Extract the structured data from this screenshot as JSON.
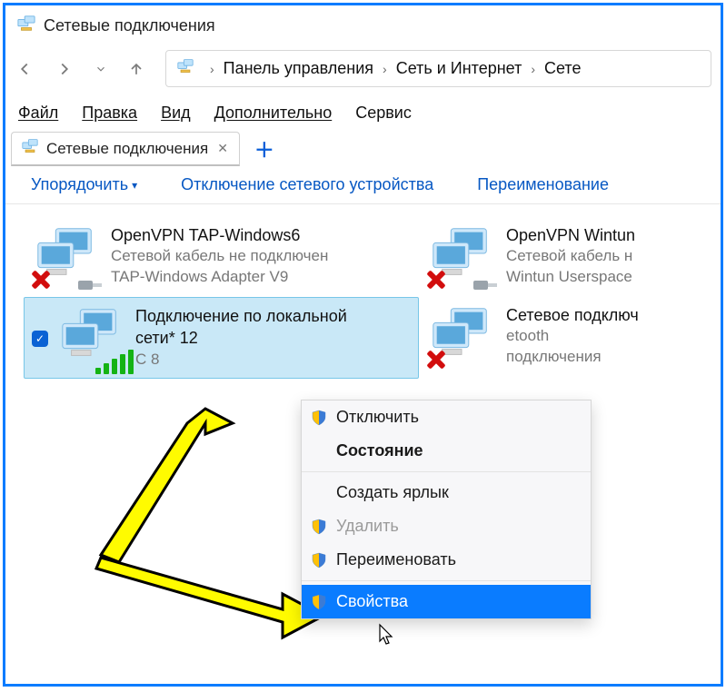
{
  "window": {
    "title": "Сетевые подключения"
  },
  "breadcrumb": {
    "parts": [
      "Панель управления",
      "Сеть и Интернет",
      "Сете"
    ]
  },
  "menu": {
    "file": "Файл",
    "edit": "Правка",
    "view": "Вид",
    "advanced": "Дополнительно",
    "service": "Сервис"
  },
  "tab": {
    "label": "Сетевые подключения"
  },
  "toolbar": {
    "organize": "Упорядочить",
    "disable": "Отключение сетевого устройства",
    "rename": "Переименование"
  },
  "connections": [
    {
      "name": "OpenVPN TAP-Windows6",
      "sub1": "Сетевой кабель не подключен",
      "sub2": "TAP-Windows Adapter V9",
      "status": "disconnected"
    },
    {
      "name": "OpenVPN Wintun",
      "sub1": "Сетевой кабель н",
      "sub2": "Wintun Userspace",
      "status": "disconnected"
    },
    {
      "name": "Подключение по локальной сети* 12",
      "name_line1": "Подключение по локальной",
      "name_line2": "сети* 12",
      "sub1": "С         8",
      "sub2": "",
      "status": "connected",
      "selected": true
    },
    {
      "name": "Сетевое подключ",
      "name_line1": "Сетевое подключ",
      "sub1": "etooth",
      "sub2": "  подключения",
      "status": "disconnected"
    }
  ],
  "context_menu": {
    "disable": "Отключить",
    "status": "Состояние",
    "shortcut": "Создать ярлык",
    "delete": "Удалить",
    "rename": "Переименовать",
    "properties": "Свойства"
  }
}
